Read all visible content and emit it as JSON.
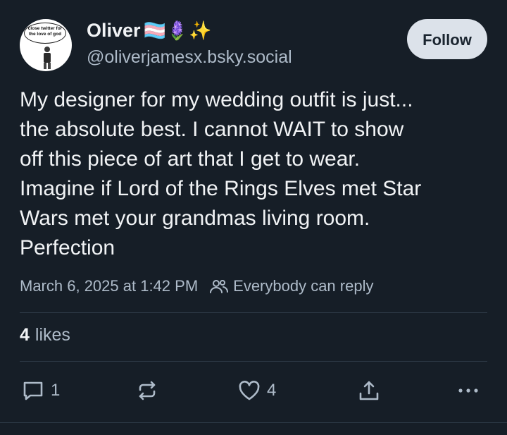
{
  "author": {
    "display_name": "Oliver",
    "name_emojis": "🏳️‍⚧️🪻✨",
    "handle": "@oliverjamesx.bsky.social",
    "avatar_caption": "close twitter for the love of god"
  },
  "follow_button": {
    "label": "Follow"
  },
  "post": {
    "lines": [
      "My designer for my wedding outfit is just...",
      "the absolute best. I cannot WAIT to show",
      "off this piece of art that I get to wear.",
      "Imagine if Lord of the Rings Elves met Star",
      "Wars met your grandmas living room.",
      "Perfection"
    ],
    "timestamp": "March 6, 2025 at 1:42 PM",
    "reply_setting": "Everybody can reply"
  },
  "stats": {
    "likes_count": "4",
    "likes_label": "likes"
  },
  "actions": {
    "reply_count": "1",
    "like_count": "4"
  },
  "icons": {
    "reply": "speech-bubble-icon",
    "repost": "repost-icon",
    "like": "heart-icon",
    "share": "share-icon",
    "more": "ellipsis-icon",
    "reply_setting": "people-icon"
  },
  "colors": {
    "background": "#161e27",
    "text_primary": "#f1f3f5",
    "text_secondary": "#aebbc9",
    "follow_button_bg": "#dce2ea",
    "divider": "#2e3a47"
  }
}
